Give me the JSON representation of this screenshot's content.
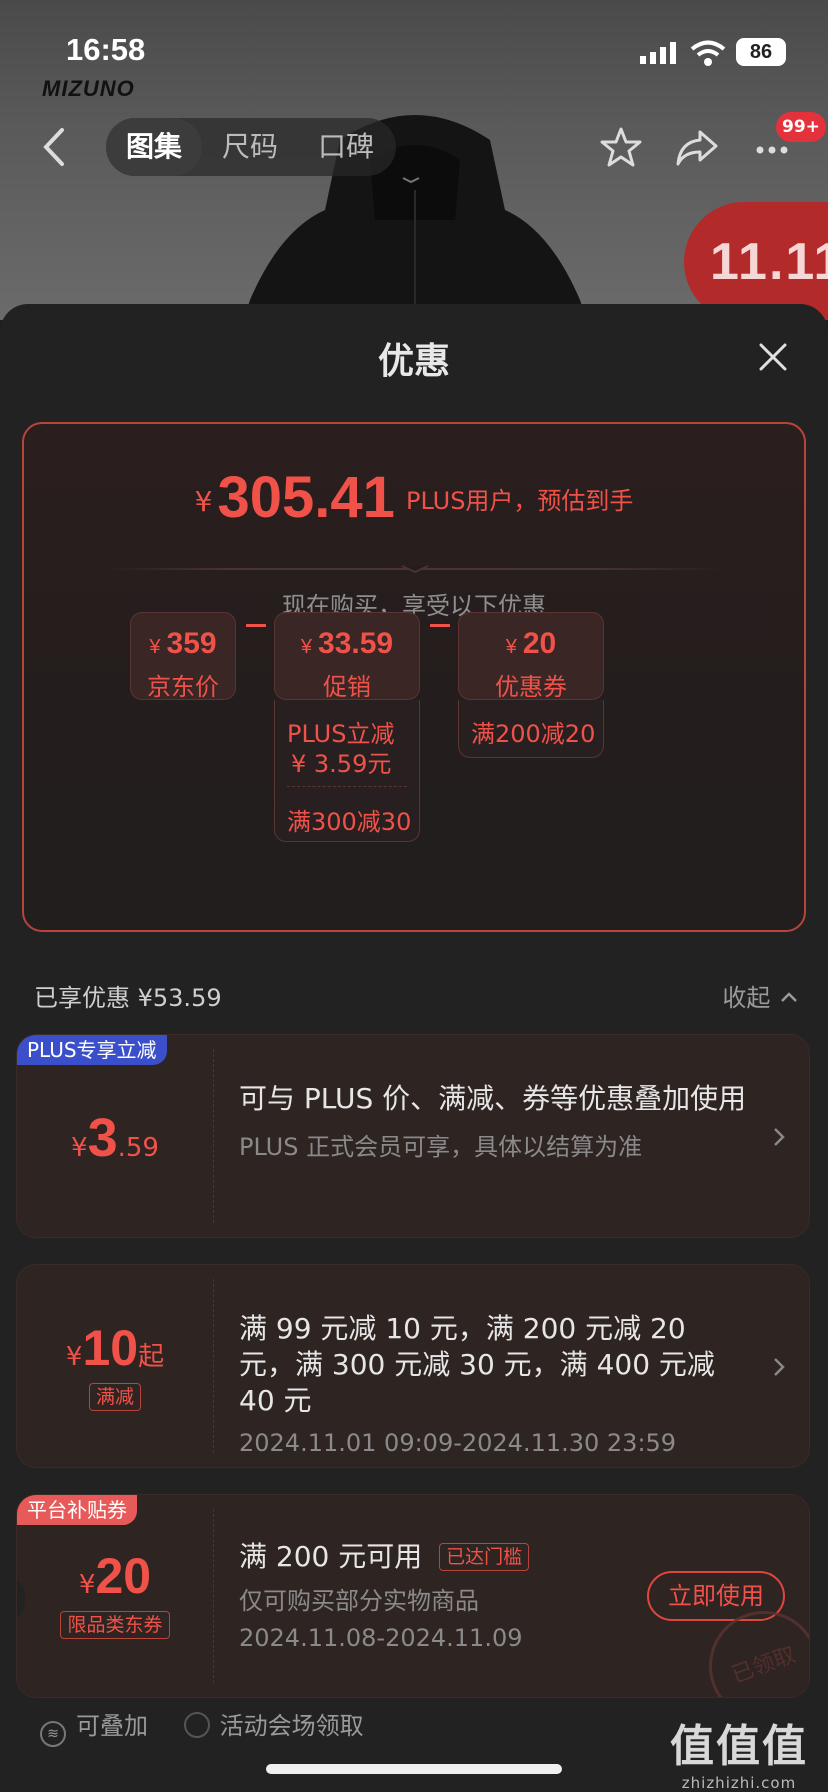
{
  "status_bar": {
    "time": "16:58",
    "battery": "86"
  },
  "brand": {
    "logo_text": "MIZUNO"
  },
  "nav": {
    "tabs": [
      "图集",
      "尺码",
      "口碑"
    ],
    "active_tab": 0,
    "badge": "99+"
  },
  "promo_banner": {
    "text": "11.11"
  },
  "sheet": {
    "title": "优惠",
    "summary": {
      "currency": "¥",
      "estimate_price": "305.41",
      "estimate_label": "PLUS用户，预估到手",
      "hint": "现在购买，享受以下优惠",
      "items": [
        {
          "currency": "¥",
          "value": "359",
          "label": "京东价"
        },
        {
          "currency": "¥",
          "value": "33.59",
          "label": "促销",
          "details": [
            "PLUS立减",
            "¥ 3.59元",
            "满300减30"
          ]
        },
        {
          "currency": "¥",
          "value": "20",
          "label": "优惠券",
          "details": [
            "满200减20"
          ]
        }
      ]
    },
    "enjoyed_label": "已享优惠 ¥53.59",
    "collapse_label": "收起",
    "cards": [
      {
        "corner_tag": "PLUS专享立减",
        "currency": "¥",
        "amount_int": "3",
        "amount_dec": ".59",
        "title": "可与 PLUS 价、满减、券等优惠叠加使用",
        "desc": "PLUS 正式会员可享，具体以结算为准"
      },
      {
        "currency": "¥",
        "amount_int": "10",
        "amount_suffix": "起",
        "type_tag": "满减",
        "title": "满 99 元减 10 元，满 200 元减 20 元，满 300 元减 30 元，满 400 元减 40 元",
        "desc": "2024.11.01 09:09-2024.11.30 23:59"
      },
      {
        "corner_tag": "平台补贴券",
        "currency": "¥",
        "amount_int": "20",
        "type_tag": "限品类东券",
        "title": "满 200 元可用",
        "status_tag": "已达门槛",
        "desc": "仅可购买部分实物商品",
        "date": "2024.11.08-2024.11.09",
        "button": "立即使用",
        "stamp": "已领取"
      }
    ],
    "footer": {
      "stackable": "可叠加",
      "source": "活动会场领取"
    }
  },
  "watermark": {
    "big": "值值值",
    "small": "zhizhizhi.com"
  },
  "colors": {
    "accent": "#f0524a",
    "plus_blue": "#3a4fc9",
    "platform_red": "#e85a5a",
    "sheet_bg": "#222222"
  }
}
